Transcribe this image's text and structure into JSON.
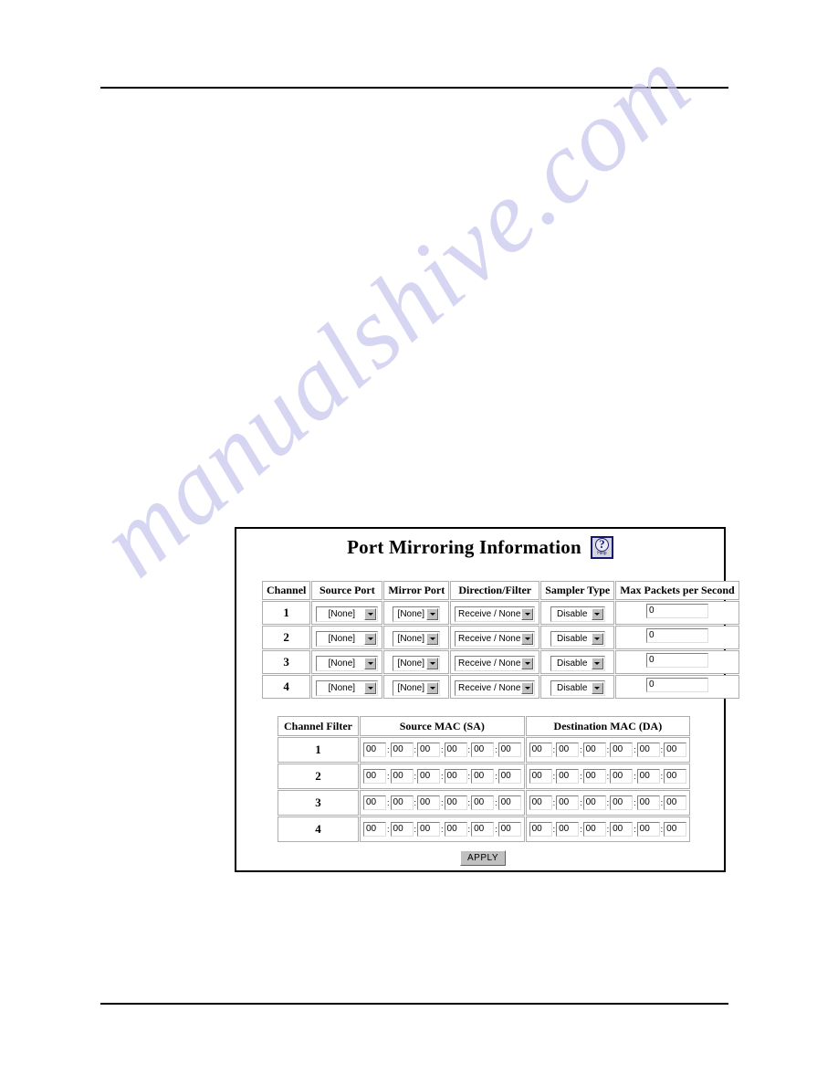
{
  "watermark": {
    "text": "manualshive.com"
  },
  "panel": {
    "title": "Port Mirroring Information",
    "help_icon": {
      "glyph": "?",
      "label": "Help"
    },
    "mirror_table": {
      "headers": [
        "Channel",
        "Source Port",
        "Mirror Port",
        "Direction/Filter",
        "Sampler Type",
        "Max Packets per Second"
      ],
      "rows": [
        {
          "channel": "1",
          "source_port": "[None]",
          "mirror_port": "[None]",
          "direction_filter": "Receive / None",
          "sampler_type": "Disable",
          "max_packets": "0"
        },
        {
          "channel": "2",
          "source_port": "[None]",
          "mirror_port": "[None]",
          "direction_filter": "Receive / None",
          "sampler_type": "Disable",
          "max_packets": "0"
        },
        {
          "channel": "3",
          "source_port": "[None]",
          "mirror_port": "[None]",
          "direction_filter": "Receive / None",
          "sampler_type": "Disable",
          "max_packets": "0"
        },
        {
          "channel": "4",
          "source_port": "[None]",
          "mirror_port": "[None]",
          "direction_filter": "Receive / None",
          "sampler_type": "Disable",
          "max_packets": "0"
        }
      ]
    },
    "mac_table": {
      "headers": [
        "Channel Filter",
        "Source MAC (SA)",
        "Destination MAC (DA)"
      ],
      "separator": ":",
      "rows": [
        {
          "filter": "1",
          "source_mac": [
            "00",
            "00",
            "00",
            "00",
            "00",
            "00"
          ],
          "destination_mac": [
            "00",
            "00",
            "00",
            "00",
            "00",
            "00"
          ]
        },
        {
          "filter": "2",
          "source_mac": [
            "00",
            "00",
            "00",
            "00",
            "00",
            "00"
          ],
          "destination_mac": [
            "00",
            "00",
            "00",
            "00",
            "00",
            "00"
          ]
        },
        {
          "filter": "3",
          "source_mac": [
            "00",
            "00",
            "00",
            "00",
            "00",
            "00"
          ],
          "destination_mac": [
            "00",
            "00",
            "00",
            "00",
            "00",
            "00"
          ]
        },
        {
          "filter": "4",
          "source_mac": [
            "00",
            "00",
            "00",
            "00",
            "00",
            "00"
          ],
          "destination_mac": [
            "00",
            "00",
            "00",
            "00",
            "00",
            "00"
          ]
        }
      ]
    },
    "apply_button": "APPLY"
  },
  "colors": {
    "help_border": "#151573",
    "widget_face": "#c0c0c0",
    "watermark": "#c9c9ee"
  }
}
